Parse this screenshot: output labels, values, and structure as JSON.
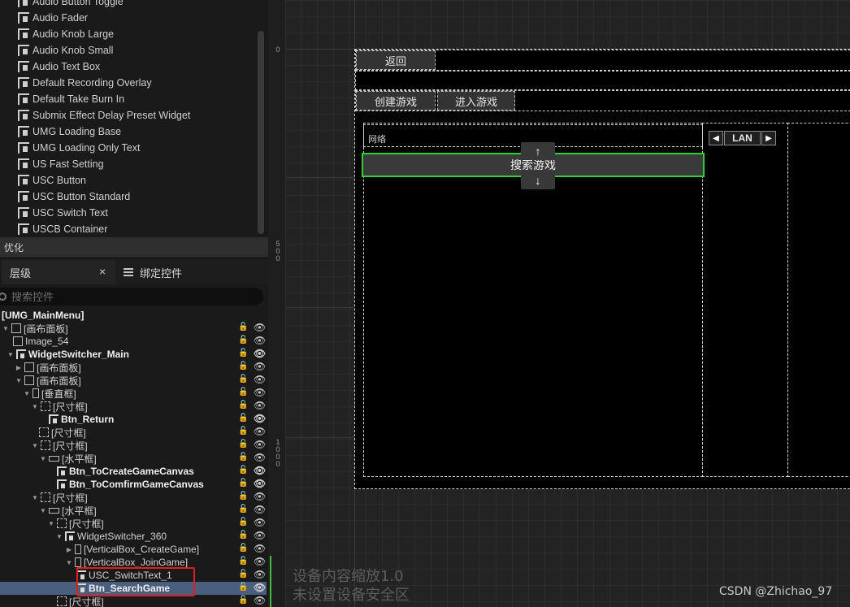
{
  "palette": {
    "items": [
      "Audio Button Toggle",
      "Audio Fader",
      "Audio Knob Large",
      "Audio Knob Small",
      "Audio Text Box",
      "Default Recording Overlay",
      "Default Take Burn In",
      "Submix Effect Delay Preset Widget",
      "UMG Loading Base",
      "UMG Loading Only Text",
      "US Fast Setting",
      "USC Button",
      "USC Button Standard",
      "USC Switch Text",
      "USCB Container"
    ],
    "section_optimize": "优化"
  },
  "tabs": {
    "hierarchy": "层级",
    "bindings": "绑定控件",
    "close": "×"
  },
  "search": {
    "placeholder": "搜索控件"
  },
  "tree": [
    {
      "label": "[UMG_MainMenu]",
      "bold": true,
      "icon": "none",
      "arrow": ""
    },
    {
      "label": "[画布面板]",
      "icon": "canvas",
      "arrow": "down"
    },
    {
      "label": "Image_54",
      "icon": "image",
      "arrow": ""
    },
    {
      "label": "WidgetSwitcher_Main",
      "bold": true,
      "icon": "switcher",
      "arrow": "down"
    },
    {
      "label": "[画布面板]",
      "icon": "canvas",
      "arrow": "right"
    },
    {
      "label": "[画布面板]",
      "icon": "canvas",
      "arrow": "down"
    },
    {
      "label": "[垂直框]",
      "icon": "vbox",
      "arrow": "down"
    },
    {
      "label": "[尺寸框]",
      "icon": "size",
      "arrow": "down"
    },
    {
      "label": "Btn_Return",
      "bold": true,
      "icon": "btn",
      "arrow": ""
    },
    {
      "label": "[尺寸框]",
      "icon": "size",
      "arrow": ""
    },
    {
      "label": "[尺寸框]",
      "icon": "size",
      "arrow": "down"
    },
    {
      "label": "[水平框]",
      "icon": "hbox",
      "arrow": "down"
    },
    {
      "label": "Btn_ToCreateGameCanvas",
      "bold": true,
      "icon": "btn",
      "arrow": ""
    },
    {
      "label": "Btn_ToComfirmGameCanvas",
      "bold": true,
      "icon": "btn",
      "arrow": ""
    },
    {
      "label": "[尺寸框]",
      "icon": "size",
      "arrow": "down"
    },
    {
      "label": "[水平框]",
      "icon": "hbox",
      "arrow": "down"
    },
    {
      "label": "[尺寸框]",
      "icon": "size",
      "arrow": "down"
    },
    {
      "label": "WidgetSwitcher_360",
      "icon": "switcher",
      "arrow": "down"
    },
    {
      "label": "[VerticalBox_CreateGame]",
      "icon": "vbox",
      "arrow": "right"
    },
    {
      "label": "[VerticalBox_JoinGame]",
      "icon": "vbox",
      "arrow": "down"
    },
    {
      "label": "USC_SwitchText_1",
      "icon": "btn",
      "arrow": ""
    },
    {
      "label": "Btn_SearchGame",
      "bold": true,
      "selected": true,
      "icon": "btn",
      "arrow": ""
    },
    {
      "label": "[尺寸框]",
      "icon": "size",
      "arrow": ""
    }
  ],
  "ruler": {
    "labels": [
      "0",
      "5\n0\n0",
      "1\n0\n0\n0"
    ]
  },
  "designer": {
    "btn_return": "返回",
    "btn_create": "创建游戏",
    "btn_join": "进入游戏",
    "network_label": "网络",
    "lan_value": "LAN",
    "btn_search": "搜索游戏",
    "nav_up": "↑",
    "nav_down": "↓",
    "arrow_left": "◀",
    "arrow_right": "▶"
  },
  "status": {
    "scale_line": "设备内容缩放1.0",
    "safe_zone_line": "未设置设备安全区"
  },
  "watermark": "CSDN @Zhichao_97",
  "colors": {
    "selection": "#4a5e7d",
    "focus_outline": "#2ed12e",
    "annotation_box": "#e11d1d"
  }
}
